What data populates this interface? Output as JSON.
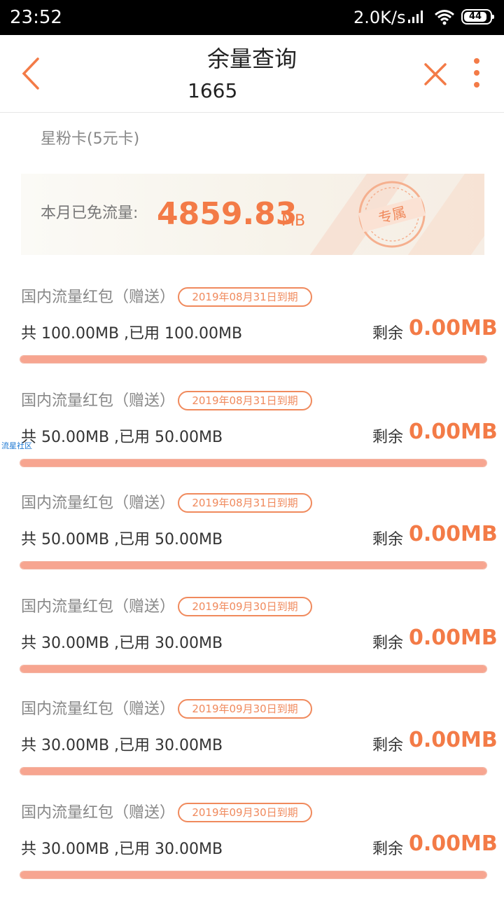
{
  "status_bar": {
    "time": "23:52",
    "speed": "2.0K/s",
    "battery": "44"
  },
  "header": {
    "title": "余量查询",
    "subtitle": "1665"
  },
  "card_name": "星粉卡(5元卡)",
  "banner": {
    "label": "本月已免流量:",
    "value": "4859.83",
    "unit": "MB",
    "stamp_text": "专属"
  },
  "watermark": "流星社区",
  "items": [
    {
      "title": "国内流量红包（赠送）",
      "expiry": "2019年08月31日到期",
      "total_text": "共 100.00MB ,已用 100.00MB",
      "remain_label": "剩余",
      "remain_value": "0.00MB",
      "used_fraction": 1.0
    },
    {
      "title": "国内流量红包（赠送）",
      "expiry": "2019年08月31日到期",
      "total_text": "共 50.00MB ,已用 50.00MB",
      "remain_label": "剩余",
      "remain_value": "0.00MB",
      "used_fraction": 1.0
    },
    {
      "title": "国内流量红包（赠送）",
      "expiry": "2019年08月31日到期",
      "total_text": "共 50.00MB ,已用 50.00MB",
      "remain_label": "剩余",
      "remain_value": "0.00MB",
      "used_fraction": 1.0
    },
    {
      "title": "国内流量红包（赠送）",
      "expiry": "2019年09月30日到期",
      "total_text": "共 30.00MB ,已用 30.00MB",
      "remain_label": "剩余",
      "remain_value": "0.00MB",
      "used_fraction": 1.0
    },
    {
      "title": "国内流量红包（赠送）",
      "expiry": "2019年09月30日到期",
      "total_text": "共 30.00MB ,已用 30.00MB",
      "remain_label": "剩余",
      "remain_value": "0.00MB",
      "used_fraction": 1.0
    },
    {
      "title": "国内流量红包（赠送）",
      "expiry": "2019年09月30日到期",
      "total_text": "共 30.00MB ,已用 30.00MB",
      "remain_label": "剩余",
      "remain_value": "0.00MB",
      "used_fraction": 1.0
    }
  ],
  "colors": {
    "accent": "#f37b47",
    "badge": "#f08a5d",
    "bar": "#f7a590"
  }
}
